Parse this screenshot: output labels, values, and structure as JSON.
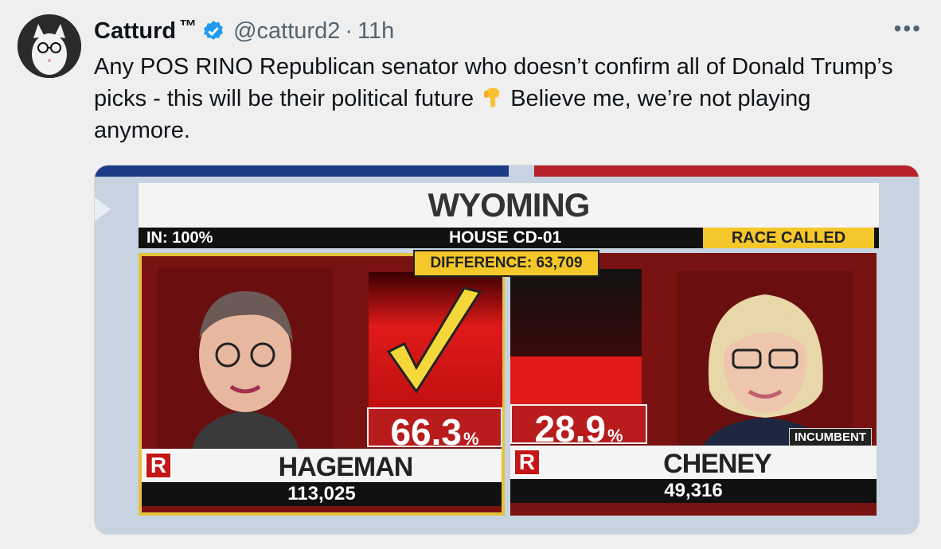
{
  "tweet": {
    "author_name": "Catturd",
    "tm": "™",
    "handle": "@catturd2",
    "separator": "·",
    "time": "11h",
    "more": "•••",
    "text_part1": "Any POS RINO Republican senator who doesn’t confirm all of Donald Trump’s picks - this will be their political future",
    "emoji": "backhand-index-pointing-down",
    "text_part2": "Believe me, we’re not playing anymore."
  },
  "media": {
    "title": "WYOMING",
    "in_pct": "IN: 100%",
    "district": "HOUSE CD-01",
    "race_called": "RACE CALLED",
    "difference": "DIFFERENCE: 63,709",
    "candidates": [
      {
        "party": "R",
        "name": "HAGEMAN",
        "pct": "66.3",
        "pct_sign": "%",
        "votes": "113,025",
        "winner": true
      },
      {
        "party": "R",
        "name": "CHENEY",
        "pct": "28.9",
        "pct_sign": "%",
        "votes": "49,316",
        "incumbent": "INCUMBENT"
      }
    ]
  },
  "colors": {
    "verified": "#1d9bf0",
    "republican": "#c41616",
    "highlight": "#f4c72a"
  }
}
